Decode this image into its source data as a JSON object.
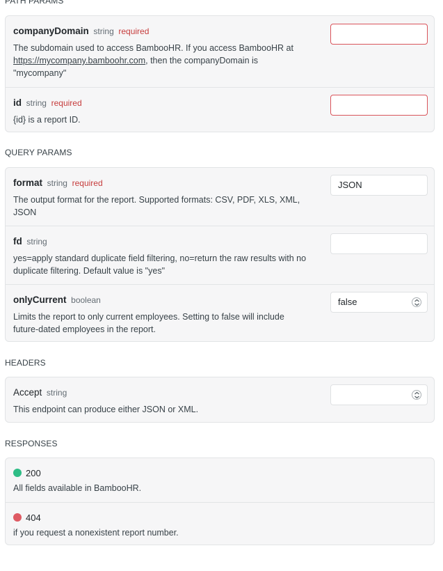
{
  "sections": {
    "path_params": "PATH PARAMS",
    "query_params": "QUERY PARAMS",
    "headers": "HEADERS",
    "responses": "RESPONSES"
  },
  "path_params": [
    {
      "name": "companyDomain",
      "type": "string",
      "required": "required",
      "desc_part1": "The subdomain used to access BambooHR. If you access BambooHR at",
      "desc_link": "https://mycompany.bamboohr.com",
      "desc_part2": ", then the companyDomain is",
      "desc_part3": "\"mycompany\"",
      "value": ""
    },
    {
      "name": "id",
      "type": "string",
      "required": "required",
      "desc": "{id} is a report ID.",
      "value": ""
    }
  ],
  "query_params": [
    {
      "name": "format",
      "type": "string",
      "required": "required",
      "desc_line1": "The output format for the report. Supported formats: CSV, PDF, XLS, XML,",
      "desc_line2": "JSON",
      "value": "JSON"
    },
    {
      "name": "fd",
      "type": "string",
      "desc_line1": "yes=apply standard duplicate field filtering, no=return the raw results with no",
      "desc_line2": "duplicate filtering. Default value is \"yes\"",
      "value": ""
    },
    {
      "name": "onlyCurrent",
      "type": "boolean",
      "desc_line1": "Limits the report to only current employees. Setting to false will include",
      "desc_line2": "future-dated employees in the report.",
      "value": "false"
    }
  ],
  "headers": [
    {
      "name": "Accept",
      "type": "string",
      "desc": "This endpoint can produce either JSON or XML.",
      "value": ""
    }
  ],
  "responses": [
    {
      "code": "200",
      "desc": "All fields available in BambooHR.",
      "color": "#2ebd86"
    },
    {
      "code": "404",
      "desc": "if you request a nonexistent report number.",
      "color": "#de5a63"
    }
  ]
}
